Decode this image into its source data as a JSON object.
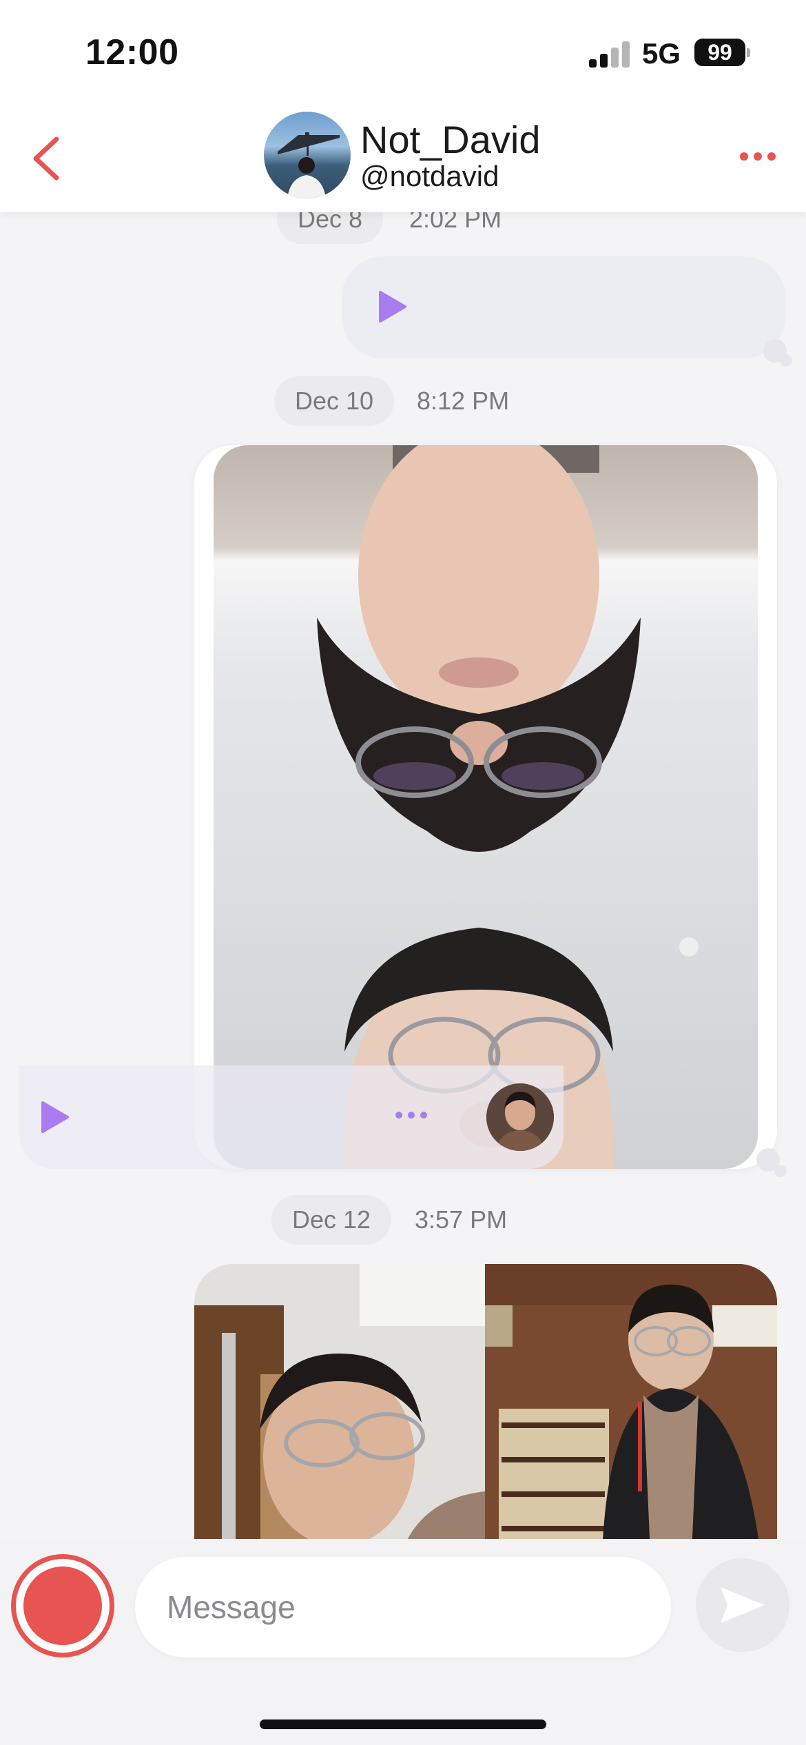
{
  "status_bar": {
    "time": "12:00",
    "network": "5G",
    "battery": "99"
  },
  "header": {
    "display_name": "Not_David",
    "handle": "@notdavid"
  },
  "messages": [
    {
      "date": "Dec 8",
      "time": "2:02 PM",
      "type": "voice"
    },
    {
      "date": "Dec 10",
      "time": "8:12 PM",
      "type": "video"
    },
    {
      "date": "Dec 12",
      "time": "3:57 PM",
      "type": "photos"
    }
  ],
  "composer": {
    "placeholder": "Message"
  },
  "icons": {
    "back": "chevron-left-icon",
    "more": "more-horizontal-icon",
    "play": "play-icon",
    "record": "record-icon",
    "send": "send-icon"
  },
  "colors": {
    "accent_red": "#e85451",
    "accent_purple": "#a97cf0"
  }
}
